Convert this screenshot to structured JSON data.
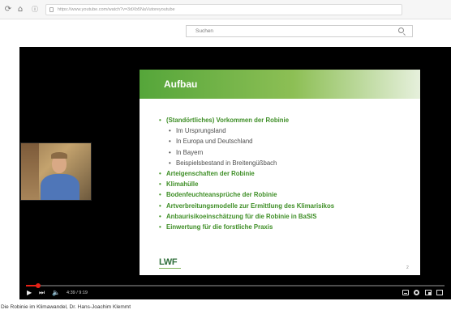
{
  "browser": {
    "url": "https://www.youtube.com/watch?v=3dXb5NaVutoreyoutube"
  },
  "header": {
    "search_placeholder": "Suchen"
  },
  "slide": {
    "title": "Aufbau",
    "bullets": [
      {
        "level": 1,
        "text": "(Standörtliches) Vorkommen der Robinie"
      },
      {
        "level": 2,
        "text": "Im Ursprungsland"
      },
      {
        "level": 2,
        "text": "In Europa und Deutschland"
      },
      {
        "level": 2,
        "text": "In Bayern"
      },
      {
        "level": 2,
        "text": "Beispielsbestand in Breitengüßbach"
      },
      {
        "level": 1,
        "text": "Arteigenschaften der Robinie"
      },
      {
        "level": 1,
        "text": "Klimahülle"
      },
      {
        "level": 1,
        "text": "Bodenfeuchteansprüche der Robinie"
      },
      {
        "level": 1,
        "text": "Artverbreitungsmodelle zur Ermittlung des Klimarisikos"
      },
      {
        "level": 1,
        "text": "Anbaurisikoeinschätzung für die Robinie in BaSIS"
      },
      {
        "level": 1,
        "text": "Einwertung für die forstliche Praxis"
      }
    ],
    "logo": "LWF",
    "page_number": "2"
  },
  "player": {
    "time": "4:39 / 9:19",
    "progress": 0.03,
    "icons": [
      "play-icon",
      "next-icon",
      "volume-icon",
      "subtitles-icon",
      "settings-icon",
      "miniplayer-icon",
      "fullscreen-icon"
    ]
  },
  "video": {
    "title": "Die Robinie im Klimawandel, Dr. Hans-Joachim Klemmt"
  },
  "colors": {
    "slide_accent": "#3e8e26",
    "progress": "#e62117"
  }
}
